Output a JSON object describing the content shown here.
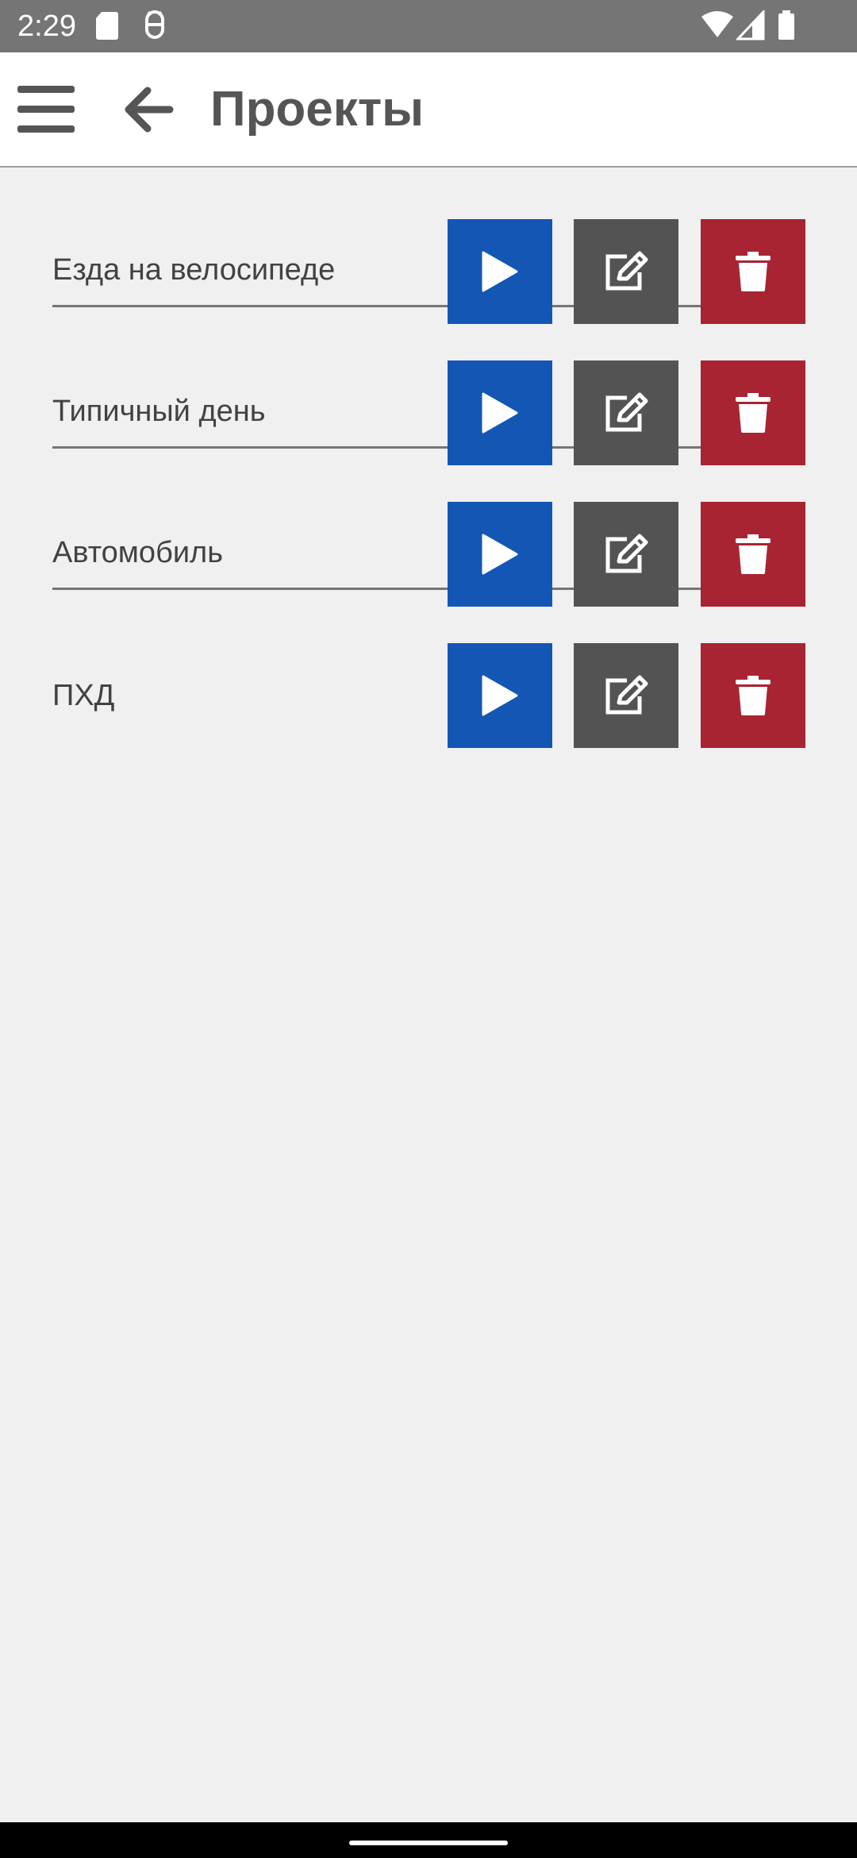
{
  "status_bar": {
    "time": "2:29",
    "icons": [
      "sd-card-icon",
      "android-debug-icon",
      "wifi-icon",
      "signal-icon",
      "battery-icon"
    ]
  },
  "app_bar": {
    "title": "Проекты",
    "menu_icon": "hamburger-menu-icon",
    "back_icon": "arrow-left-icon"
  },
  "projects": [
    {
      "name": "Езда на велосипеде"
    },
    {
      "name": "Типичный день"
    },
    {
      "name": "Автомобиль"
    },
    {
      "name": "ПХД"
    }
  ],
  "actions": {
    "play": {
      "icon": "play-icon",
      "color": "#1456b3"
    },
    "edit": {
      "icon": "edit-icon",
      "color": "#535353"
    },
    "delete": {
      "icon": "trash-icon",
      "color": "#a82432"
    }
  },
  "colors": {
    "status_bar": "#757575",
    "app_bar": "#ffffff",
    "background": "#f0f0f0",
    "text": "#424242",
    "title": "#555555"
  }
}
